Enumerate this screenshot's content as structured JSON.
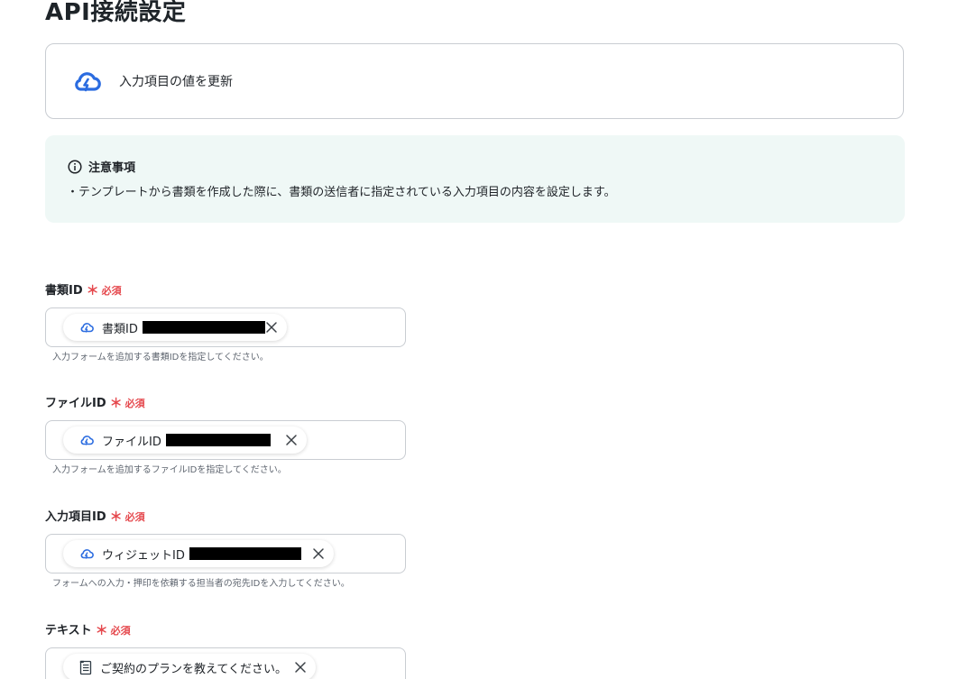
{
  "page": {
    "title": "API接続設定"
  },
  "action": {
    "icon": "cloud-app-icon",
    "label": "入力項目の値を更新"
  },
  "notice": {
    "icon": "info-icon",
    "title": "注意事項",
    "body": "・テンプレートから書類を作成した際に、書類の送信者に指定されている入力項目の内容を設定します。"
  },
  "fields": [
    {
      "label": "書類ID",
      "required_mark": "＊",
      "required_text": "必須",
      "chip_icon": "cloud-app-icon",
      "chip_text": "書類ID",
      "hint": "入力フォームを追加する書類IDを指定してください。"
    },
    {
      "label": "ファイルID",
      "required_mark": "＊",
      "required_text": "必須",
      "chip_icon": "cloud-app-icon",
      "chip_text": "ファイルID",
      "hint": "入力フォームを追加するファイルIDを指定してください。"
    },
    {
      "label": "入力項目ID",
      "required_mark": "＊",
      "required_text": "必須",
      "chip_icon": "cloud-app-icon",
      "chip_text": "ウィジェットID",
      "hint": "フォームへの入力・押印を依頼する担当者の宛先IDを入力してください。"
    },
    {
      "label": "テキスト",
      "required_mark": "＊",
      "required_text": "必須",
      "chip_icon": "form-document-icon",
      "chip_text": "ご契約のプランを教えてください。",
      "hint": ""
    }
  ],
  "colors": {
    "brand_blue": "#2b6ce0",
    "required_red": "#e5484d",
    "notice_bg": "#eff8f6",
    "border": "#c9cdd2"
  }
}
